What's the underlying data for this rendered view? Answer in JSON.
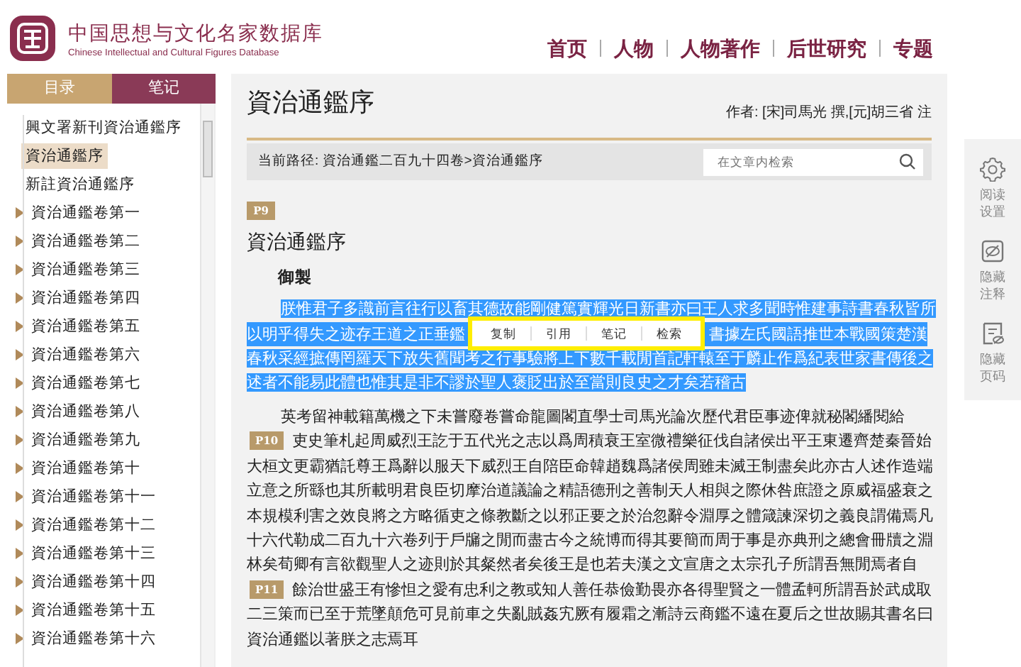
{
  "header": {
    "title": "中国思想与文化名家数据库",
    "subtitle": "Chinese Intellectual and Cultural Figures Database",
    "nav": [
      "首页",
      "人物",
      "人物著作",
      "后世研究",
      "专题"
    ]
  },
  "sidebar": {
    "tabs": [
      {
        "label": "目录",
        "selected": true
      },
      {
        "label": "笔记",
        "selected": false
      }
    ],
    "items": [
      {
        "text": "興文署新刊資治通鑑序",
        "kind": "leaf",
        "selected": false
      },
      {
        "text": "資治通鑑序",
        "kind": "leaf",
        "selected": true
      },
      {
        "text": "新註資治通鑑序",
        "kind": "leaf",
        "selected": false
      },
      {
        "text": "資治通鑑卷第一",
        "kind": "folder",
        "selected": false
      },
      {
        "text": "資治通鑑卷第二",
        "kind": "folder",
        "selected": false
      },
      {
        "text": "資治通鑑卷第三",
        "kind": "folder",
        "selected": false
      },
      {
        "text": "資治通鑑卷第四",
        "kind": "folder",
        "selected": false
      },
      {
        "text": "資治通鑑卷第五",
        "kind": "folder",
        "selected": false
      },
      {
        "text": "資治通鑑卷第六",
        "kind": "folder",
        "selected": false
      },
      {
        "text": "資治通鑑卷第七",
        "kind": "folder",
        "selected": false
      },
      {
        "text": "資治通鑑卷第八",
        "kind": "folder",
        "selected": false
      },
      {
        "text": "資治通鑑卷第九",
        "kind": "folder",
        "selected": false
      },
      {
        "text": "資治通鑑卷第十",
        "kind": "folder",
        "selected": false
      },
      {
        "text": "資治通鑑卷第十一",
        "kind": "folder",
        "selected": false
      },
      {
        "text": "資治通鑑卷第十二",
        "kind": "folder",
        "selected": false
      },
      {
        "text": "資治通鑑卷第十三",
        "kind": "folder",
        "selected": false
      },
      {
        "text": "資治通鑑卷第十四",
        "kind": "folder",
        "selected": false
      },
      {
        "text": "資治通鑑卷第十五",
        "kind": "folder",
        "selected": false
      },
      {
        "text": "資治通鑑卷第十六",
        "kind": "folder",
        "selected": false
      }
    ]
  },
  "document": {
    "title": "資治通鑑序",
    "author": "作者: [宋]司馬光 撰,[元]胡三省 注",
    "path": "当前路径: 資治通鑑二百九十四卷>資治通鑑序",
    "search": {
      "placeholder": "在文章内检索"
    },
    "blocks": [
      {
        "kind": "page",
        "label": "P9"
      },
      {
        "kind": "heading",
        "text": "資治通鑑序"
      },
      {
        "kind": "subheading",
        "text": "御製"
      },
      {
        "kind": "paragraph",
        "selected": true,
        "lines": [
          {
            "text": "朕惟君子多識前言往行以畜其德故能剛健篤實輝光日新書亦曰王人求多聞時惟建事詩書春秋皆所"
          },
          {
            "segments": [
              "以明乎得失之迹存王道之正垂鑑",
              "書據左氏國語推世本戰國策楚漢"
            ]
          },
          {
            "text": "春秋采經摭傳罔羅天下放失舊聞考之行事驗將上下數千載閒首記軒轅至于麟止作爲紀表世家書傳後之"
          },
          {
            "text": "述者不能易此體也惟其是非不謬於聖人褒貶出於至當則良史之才矣若稽古"
          }
        ]
      },
      {
        "kind": "paragraph",
        "selected": false,
        "lines": [
          {
            "text": "英考留神載籍萬機之下未嘗廢卷嘗命龍圖閣直學士司馬光論次歷代君臣事迹俾就秘閣繙閱給"
          },
          {
            "page": "P10",
            "text": "吏史筆札起周威烈王訖于五代光之志以爲周積衰王室微禮樂征伐自諸侯出平王東遷齊楚秦晉始"
          },
          {
            "text": "大桓文更霸猶託尊王爲辭以服天下威烈王自陪臣命韓趙魏爲諸侯周雖未滅王制盡矣此亦古人述作造端"
          },
          {
            "text": "立意之所繇也其所載明君良臣切摩治道議論之精語德刑之善制天人相與之際休咎庶證之原威福盛衰之"
          },
          {
            "text": "本規模利害之效良將之方略循吏之條教斷之以邪正要之於治忽辭令淵厚之體箴諫深切之義良謂備焉凡"
          },
          {
            "text": "十六代勒成二百九十六卷列于戶牖之閒而盡古今之統博而得其要簡而周于事是亦典刑之總會冊牘之淵"
          },
          {
            "text": "林矣荀卿有言欲觀聖人之迹則於其粲然者矣後王是也若夫漢之文宣唐之太宗孔子所謂吾無閒焉者自"
          },
          {
            "page": "P11",
            "text": "餘治世盛王有慘怛之愛有忠利之教或知人善任恭儉勤畏亦各得聖賢之一體孟軻所謂吾於武成取"
          },
          {
            "text": "二三策而已至于荒墜顛危可見前車之失亂賊姦宄厥有履霜之漸詩云商鑑不遠在夏后之世故賜其書名曰"
          },
          {
            "text": "資治通鑑以著朕之志焉耳"
          }
        ]
      }
    ]
  },
  "selection_toolbar": [
    "复制",
    "引用",
    "笔记",
    "检索"
  ],
  "rail": [
    {
      "kind": "settings",
      "label": "阅读设置"
    },
    {
      "kind": "hide_notes",
      "label": "隐藏注释"
    },
    {
      "kind": "hide_pages",
      "label": "隐藏页码"
    }
  ]
}
